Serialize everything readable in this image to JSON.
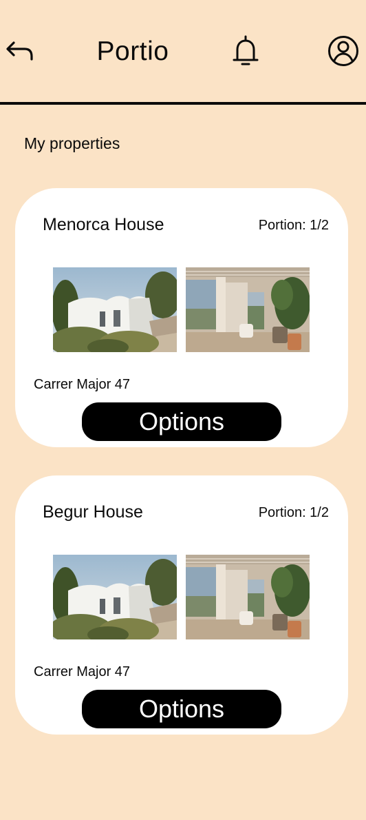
{
  "header": {
    "title": "Portio",
    "back_icon": "back-arrow-icon",
    "notifications_icon": "bell-icon",
    "profile_icon": "user-circle-icon"
  },
  "section": {
    "title": "My properties"
  },
  "properties": [
    {
      "name": "Menorca House",
      "portion": "Portion: 1/2",
      "address": "Carrer Major 47",
      "options_label": "Options"
    },
    {
      "name": "Begur House",
      "portion": "Portion: 1/2",
      "address": "Carrer Major 47",
      "options_label": "Options"
    }
  ],
  "colors": {
    "background": "#fbe3c6",
    "card": "#ffffff",
    "button": "#000000",
    "button_text": "#ffffff"
  }
}
